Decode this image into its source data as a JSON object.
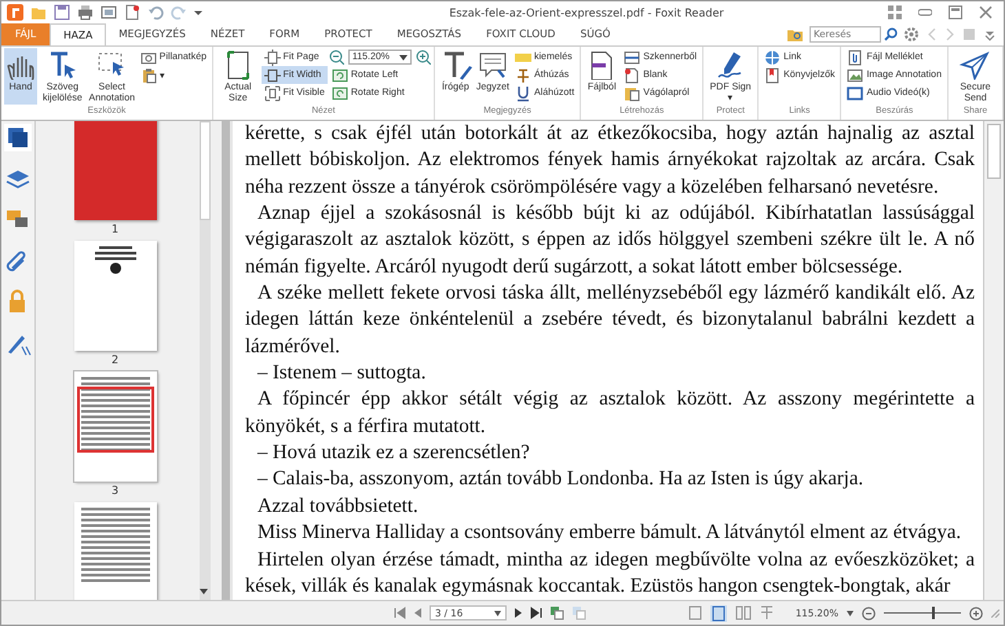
{
  "window": {
    "title": "Eszak-fele-az-Orient-expresszel.pdf - Foxit Reader"
  },
  "tabs": [
    {
      "label": "FÁJL",
      "kind": "file",
      "selected": false
    },
    {
      "label": "HAZA",
      "kind": "tab",
      "selected": true
    },
    {
      "label": "MEGJEGYZÉS",
      "kind": "tab",
      "selected": false
    },
    {
      "label": "NÉZET",
      "kind": "tab",
      "selected": false
    },
    {
      "label": "FORM",
      "kind": "tab",
      "selected": false
    },
    {
      "label": "PROTECT",
      "kind": "tab",
      "selected": false
    },
    {
      "label": "MEGOSZTÁS",
      "kind": "tab",
      "selected": false
    },
    {
      "label": "FOXIT CLOUD",
      "kind": "tab",
      "selected": false
    },
    {
      "label": "SÚGÓ",
      "kind": "tab",
      "selected": false
    }
  ],
  "search": {
    "placeholder": "Keresés"
  },
  "ribbon": [
    {
      "label": "Eszközök",
      "items": [
        {
          "kind": "large",
          "label": "Hand",
          "selected": true
        },
        {
          "kind": "large",
          "label": "Szöveg kijelölése",
          "selected": false
        },
        {
          "kind": "large",
          "label": "Select Annotation",
          "selected": false
        },
        {
          "kind": "stack",
          "buttons": [
            {
              "label": "Pillanatkép",
              "selected": false
            },
            {
              "label": "▾",
              "selected": false
            }
          ]
        }
      ]
    },
    {
      "label": "Nézet",
      "items": [
        {
          "kind": "large",
          "label": "Actual Size",
          "selected": false
        },
        {
          "kind": "stack",
          "buttons": [
            {
              "label": "Fit Page",
              "selected": false
            },
            {
              "label": "Fit Width",
              "selected": true
            },
            {
              "label": "Fit Visible",
              "selected": false
            }
          ]
        },
        {
          "kind": "zoom",
          "value": "115.20%",
          "buttons": [
            {
              "label": "Rotate Left",
              "selected": false
            },
            {
              "label": "Rotate Right",
              "selected": false
            }
          ]
        }
      ]
    },
    {
      "label": "Megjegyzés",
      "items": [
        {
          "kind": "large",
          "label": "Írógép",
          "selected": false
        },
        {
          "kind": "large",
          "label": "Jegyzet",
          "selected": false
        },
        {
          "kind": "stack",
          "buttons": [
            {
              "label": "kiemelés",
              "selected": false
            },
            {
              "label": "Áthúzás",
              "selected": false
            },
            {
              "label": "Aláhúzott",
              "selected": false
            }
          ]
        }
      ]
    },
    {
      "label": "Létrehozás",
      "items": [
        {
          "kind": "large",
          "label": "Fájlból",
          "selected": false
        },
        {
          "kind": "stack",
          "buttons": [
            {
              "label": "Szkennerből",
              "selected": false
            },
            {
              "label": "Blank",
              "selected": false
            },
            {
              "label": "Vágólapról",
              "selected": false
            }
          ]
        }
      ]
    },
    {
      "label": "Protect",
      "items": [
        {
          "kind": "large",
          "label": "PDF Sign ▾",
          "selected": false
        }
      ]
    },
    {
      "label": "Links",
      "items": [
        {
          "kind": "stack",
          "buttons": [
            {
              "label": "Link",
              "selected": false
            },
            {
              "label": "Könyvjelzők",
              "selected": false
            }
          ]
        }
      ]
    },
    {
      "label": "Beszúrás",
      "items": [
        {
          "kind": "stack",
          "buttons": [
            {
              "label": "Fájl Melléklet",
              "selected": false
            },
            {
              "label": "Image Annotation",
              "selected": false
            },
            {
              "label": "Audio  Videó(k)",
              "selected": false
            }
          ]
        }
      ]
    },
    {
      "label": "Share",
      "items": [
        {
          "kind": "large",
          "label": "Secure Send",
          "selected": false
        }
      ]
    }
  ],
  "thumbnails": [
    {
      "page": "1",
      "kind": "cover",
      "selected": false
    },
    {
      "page": "2",
      "kind": "title",
      "selected": false
    },
    {
      "page": "3",
      "kind": "text",
      "selected": true
    },
    {
      "kind": "text",
      "selected": false
    }
  ],
  "document": {
    "paragraphs": [
      {
        "continued": true,
        "lines": [
          "kérette, s csak éjfél után botorkált át az étkezőkocsiba, hogy aztán hajnalig az asztal",
          "mellett bóbiskoljon. Az elektromos fények hamis árnyékokat rajzoltak az arcára. Csak",
          "néha rezzent össze a tányérok csörömpölésére vagy a közelében felharsanó nevetésre."
        ]
      },
      {
        "continued": false,
        "lines": [
          "Aznap éjjel a szokásosnál is később bújt ki az odújából. Kibírhatatlan lassúsággal",
          "végigaraszolt az asztalok között, s éppen az idős hölggyel szembeni székre ült le. A nő",
          "némán figyelte. Arcáról nyugodt derű sugárzott, a sokat látott ember bölcsessége."
        ]
      },
      {
        "continued": false,
        "lines": [
          "A széke mellett fekete orvosi táska állt, mellényzsebéből egy lázmérő kandikált elő. Az",
          "idegen láttán keze önkéntelenül a zsebére tévedt, és bizonytalanul babrálni kezdett a",
          "lázmérővel."
        ]
      },
      {
        "continued": false,
        "lines": [
          "– Istenem – suttogta."
        ]
      },
      {
        "continued": false,
        "lines": [
          "A főpincér épp akkor sétált végig az asztalok között. Az asszony megérintette a",
          "könyökét, s a férfira mutatott."
        ]
      },
      {
        "continued": false,
        "lines": [
          "– Hová utazik ez a szerencsétlen?"
        ]
      },
      {
        "continued": false,
        "lines": [
          "– Calais-ba, asszonyom, aztán tovább Londonba. Ha az Isten is úgy akarja."
        ]
      },
      {
        "continued": false,
        "lines": [
          "Azzal továbbsietett."
        ]
      },
      {
        "continued": false,
        "lines": [
          "Miss Minerva Halliday a csontsovány emberre bámult. A látványtól elment az étvágya."
        ]
      },
      {
        "continued": false,
        "lines": [
          "Hirtelen olyan érzése támadt, mintha az idegen megbűvölte volna az evőeszközöket; a",
          "kések, villák és kanalak egymásnak koccantak. Ezüstös hangon csengtek-bongtak, akár"
        ]
      }
    ]
  },
  "status_bar": {
    "page": "3 / 16",
    "zoom": "115.20%",
    "zoom_slider": {
      "level": 0.62
    }
  }
}
